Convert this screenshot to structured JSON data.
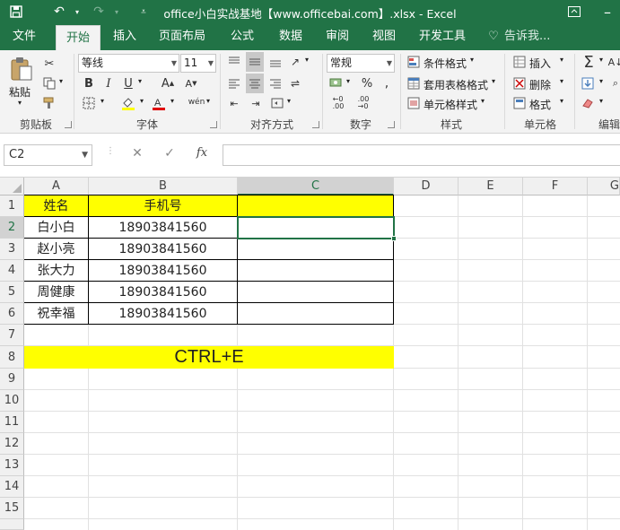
{
  "window": {
    "title": "office小白实战基地【www.officebai.com】.xlsx - Excel"
  },
  "tabs": [
    "文件",
    "开始",
    "插入",
    "页面布局",
    "公式",
    "数据",
    "审阅",
    "视图",
    "开发工具"
  ],
  "tell_me": "告诉我...",
  "ribbon": {
    "clipboard": {
      "paste": "粘贴",
      "label": "剪贴板"
    },
    "font": {
      "name": "等线",
      "size": "11",
      "label": "字体"
    },
    "alignment": {
      "label": "对齐方式"
    },
    "number": {
      "format": "常规",
      "label": "数字"
    },
    "styles": {
      "conditional": "条件格式",
      "table": "套用表格格式",
      "cell": "单元格样式",
      "label": "样式"
    },
    "cells": {
      "insert": "插入",
      "delete": "删除",
      "format": "格式",
      "label": "单元格"
    },
    "editing": {
      "label": "编辑"
    }
  },
  "formula_bar": {
    "name_box": "C2",
    "formula": ""
  },
  "sheet": {
    "columns": [
      "A",
      "B",
      "C",
      "D",
      "E",
      "F",
      "G"
    ],
    "rows": [
      "1",
      "2",
      "3",
      "4",
      "5",
      "6",
      "7",
      "8",
      "9",
      "10",
      "11",
      "12",
      "13",
      "14",
      "15"
    ],
    "header": {
      "name": "姓名",
      "phone": "手机号",
      "c": ""
    },
    "records": [
      {
        "name": "白小白",
        "phone": "18903841560"
      },
      {
        "name": "赵小亮",
        "phone": "18903841560"
      },
      {
        "name": "张大力",
        "phone": "18903841560"
      },
      {
        "name": "周健康",
        "phone": "18903841560"
      },
      {
        "name": "祝幸福",
        "phone": "18903841560"
      }
    ],
    "banner": "CTRL+E"
  },
  "colors": {
    "accent": "#217346",
    "highlight": "#ffff00"
  }
}
